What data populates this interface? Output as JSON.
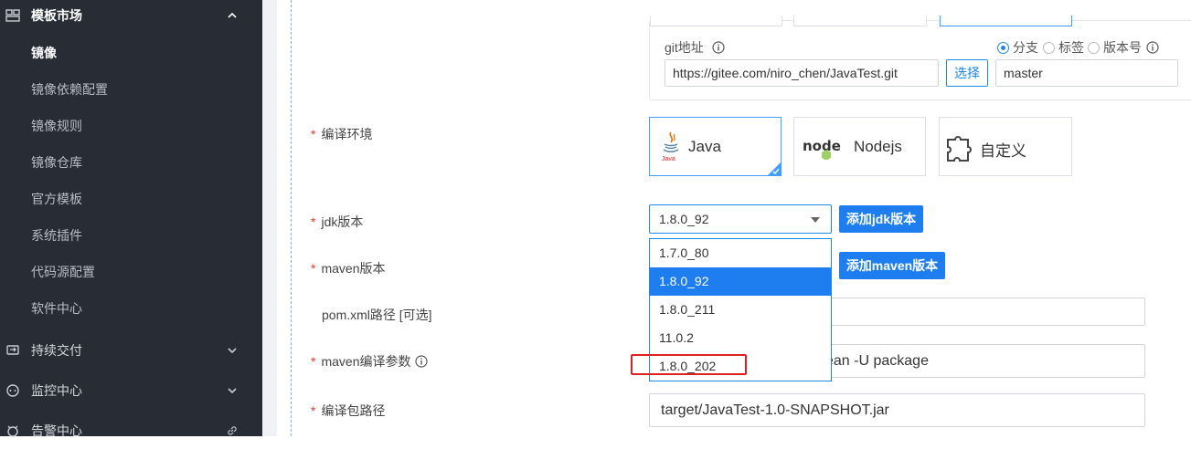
{
  "sidebar": {
    "groups": [
      {
        "label": "模板市场",
        "icon": "template-icon"
      },
      {
        "label": "持续交付",
        "icon": "delivery-icon"
      },
      {
        "label": "监控中心",
        "icon": "monitor-icon"
      },
      {
        "label": "告警中心",
        "icon": "alarm-icon"
      }
    ],
    "items": [
      {
        "label": "镜像",
        "active": true
      },
      {
        "label": "镜像依赖配置"
      },
      {
        "label": "镜像规则"
      },
      {
        "label": "镜像仓库"
      },
      {
        "label": "官方模板"
      },
      {
        "label": "系统插件"
      },
      {
        "label": "代码源配置"
      },
      {
        "label": "软件中心"
      }
    ]
  },
  "git": {
    "label": "git地址",
    "url": "https://gitee.com/niro_chen/JavaTest.git",
    "select_button": "选择",
    "ref_types": [
      "分支",
      "标签",
      "版本号"
    ],
    "selected_ref_type": "分支",
    "ref_value": "master"
  },
  "form": {
    "compile_env_label": "编译环境",
    "env_options": [
      {
        "label": "Java",
        "icon": "java-icon",
        "selected": true
      },
      {
        "label": "Nodejs",
        "icon": "node-logo",
        "selected": false
      },
      {
        "label": "自定义",
        "icon": "puzzle-icon",
        "selected": false
      }
    ],
    "jdk_label": "jdk版本",
    "jdk_value": "1.8.0_92",
    "add_jdk_button": "添加jdk版本",
    "maven_label": "maven版本",
    "add_maven_button": "添加maven版本",
    "pom_label": "pom.xml路径 [可选]",
    "maven_args_label": "maven编译参数",
    "maven_args_value": "ean -U package",
    "package_path_label": "编译包路径",
    "package_path_value": "target/JavaTest-1.0-SNAPSHOT.jar"
  },
  "jdk_dropdown": {
    "options": [
      "1.7.0_80",
      "1.8.0_92",
      "1.8.0_211",
      "11.0.2",
      "1.8.0_202"
    ],
    "selected": "1.8.0_92"
  },
  "colors": {
    "sidebar_bg": "#282c34",
    "primary": "#1e7ef0",
    "required": "#e33333",
    "highlight": "#e02020"
  }
}
